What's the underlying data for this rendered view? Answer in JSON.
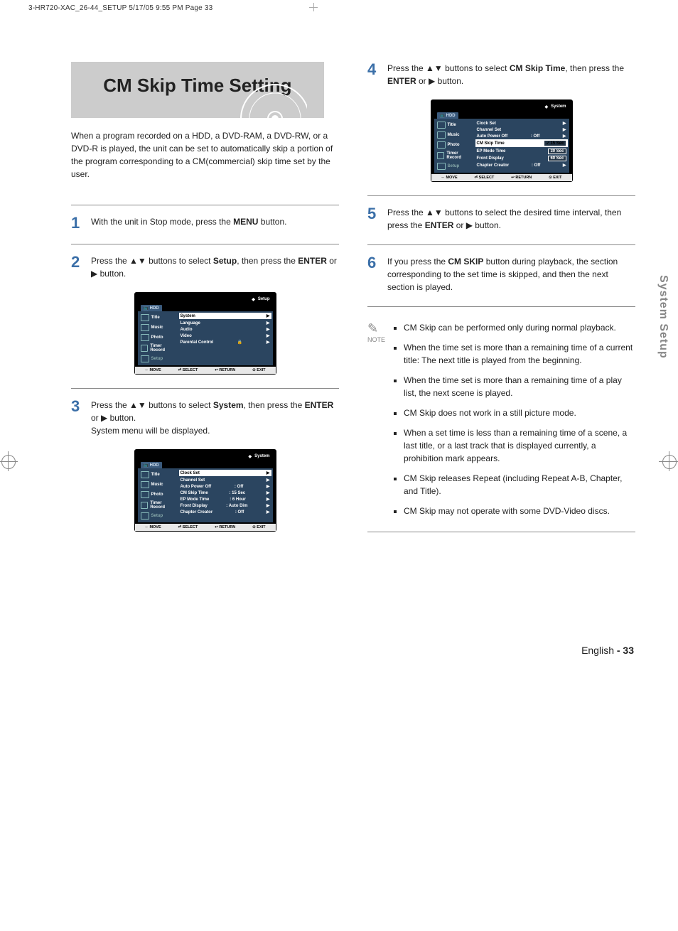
{
  "pageHeader": "3-HR720-XAC_26-44_SETUP   5/17/05   9:55 PM   Page 33",
  "featureTitle": "CM Skip Time Setting",
  "intro": "When a program recorded on a HDD, a DVD-RAM, a DVD-RW, or a DVD-R is played, the unit can be set to automatically skip a portion of the program corresponding to a CM(commercial) skip time set by the user.",
  "steps": {
    "1": [
      "With the unit in Stop mode, press the ",
      "MENU",
      " button."
    ],
    "2": [
      "Press the ▲▼ buttons to select ",
      "Setup",
      ", then press the ",
      "ENTER",
      " or ▶ button."
    ],
    "3": [
      "Press the ▲▼ buttons to select ",
      "System",
      ", then press the ",
      "ENTER",
      " or ▶ button.\nSystem menu will be displayed."
    ],
    "4": [
      "Press the  ▲▼ buttons to select ",
      "CM Skip Time",
      ", then press the ",
      "ENTER",
      " or ▶ button."
    ],
    "5": [
      "Press the ▲▼ buttons to select the desired time interval, then press the ",
      "ENTER",
      " or ▶ button."
    ],
    "6": [
      "If you press the ",
      "CM SKIP",
      " button during playback, the section corresponding to the set time is skipped, and then the next section is played."
    ]
  },
  "sideTab": "System Setup",
  "noteLabel": "NOTE",
  "notes": [
    "CM Skip can be performed only during normal playback.",
    "When the time set is more than a remaining time of a current title: The next title is played from the beginning.",
    "When the time set is more than a remaining time of a play list, the next scene is played.",
    "CM Skip does not work in a still picture mode.",
    "When a set time is less than a remaining time of a scene, a last title, or a last track that is displayed currently, a prohibition mark appears.",
    "CM Skip releases Repeat (including Repeat A-B, Chapter, and Title).",
    "CM Skip may not operate with some DVD-Video discs."
  ],
  "osdCommon": {
    "hdd": "HDD",
    "side": [
      "Title",
      "Music",
      "Photo",
      "Timer Record",
      "Setup"
    ],
    "bottom": [
      "MOVE",
      "SELECT",
      "RETURN",
      "EXIT"
    ]
  },
  "osd1": {
    "topRight": "Setup",
    "items": [
      {
        "label": "System",
        "highlight": true
      },
      {
        "label": "Language"
      },
      {
        "label": "Audio"
      },
      {
        "label": "Video"
      },
      {
        "label": "Parental Control",
        "lock": true
      }
    ]
  },
  "osd2": {
    "topRight": "System",
    "items": [
      {
        "label": "Clock Set",
        "highlight": true
      },
      {
        "label": "Channel Set"
      },
      {
        "label": "Auto Power Off",
        "value": ": Off"
      },
      {
        "label": "CM Skip Time",
        "value": ": 15 Sec"
      },
      {
        "label": "EP Mode Time",
        "value": ": 6 Hour"
      },
      {
        "label": "Front Display",
        "value": ": Auto Dim"
      },
      {
        "label": "Chapter Creator",
        "value": ": Off"
      }
    ]
  },
  "osd3": {
    "topRight": "System",
    "items": [
      {
        "label": "Clock Set"
      },
      {
        "label": "Channel Set"
      },
      {
        "label": "Auto Power Off",
        "value": ": Off"
      },
      {
        "label": "CM Skip Time",
        "opt": "15 Sec",
        "check": true,
        "highlight": true
      },
      {
        "label": "EP Mode Time",
        "opt": "30 Sec"
      },
      {
        "label": "Front Display",
        "opt": "60 Sec"
      },
      {
        "label": "Chapter Creator",
        "value": ": Off"
      }
    ]
  },
  "footer": {
    "lang": "English",
    "page": "- 33"
  }
}
